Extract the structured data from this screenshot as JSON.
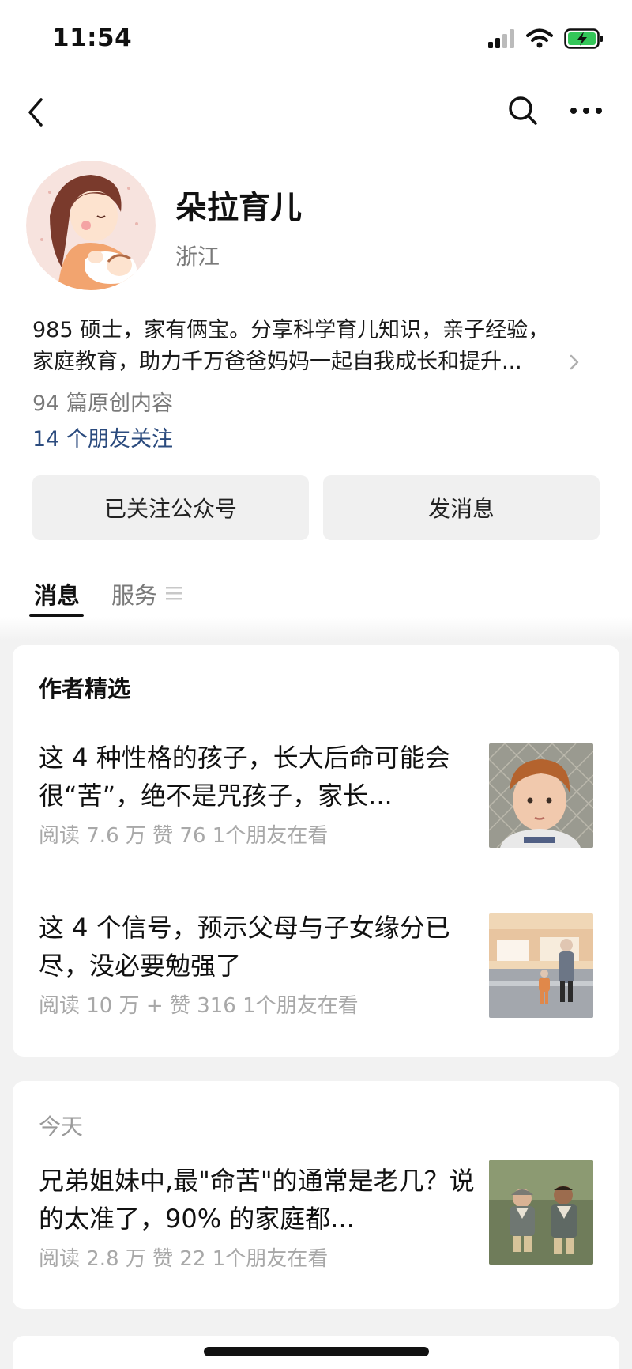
{
  "status": {
    "time": "11:54"
  },
  "profile": {
    "name": "朵拉育儿",
    "region": "浙江",
    "bio_line1": "985 硕士，家有俩宝。分享科学育儿知识，亲子经验，",
    "bio_line2": "家庭教育，助力千万爸爸妈妈一起自我成长和提升...",
    "original_count": "94 篇原创内容",
    "friends_follow": "14 个朋友关注"
  },
  "actions": {
    "follow_label": "已关注公众号",
    "message_label": "发消息"
  },
  "tabs": {
    "messages": "消息",
    "services": "服务"
  },
  "featured": {
    "title": "作者精选",
    "articles": [
      {
        "title": "这 4 种性格的孩子，长大后命可能会很“苦”，绝不是咒孩子，家长...",
        "meta": "阅读 7.6 万   赞 76   1个朋友在看"
      },
      {
        "title": "这 4 个信号，预示父母与子女缘分已尽，没必要勉强了",
        "meta": "阅读 10 万 +   赞 316   1个朋友在看"
      }
    ]
  },
  "today": {
    "label": "今天",
    "articles": [
      {
        "title": "兄弟姐妹中,最\"命苦\"的通常是老几？说的太准了，90% 的家庭都...",
        "meta": "阅读 2.8 万   赞 22   1个朋友在看"
      }
    ]
  },
  "icons": {
    "back": "chevron-left-icon",
    "search": "search-icon",
    "more": "more-dots-icon",
    "signal": "signal-icon",
    "wifi": "wifi-icon",
    "battery": "battery-charging-icon",
    "bio_more": "chevron-right-icon",
    "menu": "menu-lines-icon"
  },
  "colors": {
    "link": "#2b4b7e",
    "battery": "#34c759",
    "meta": "#a8a8a8"
  }
}
